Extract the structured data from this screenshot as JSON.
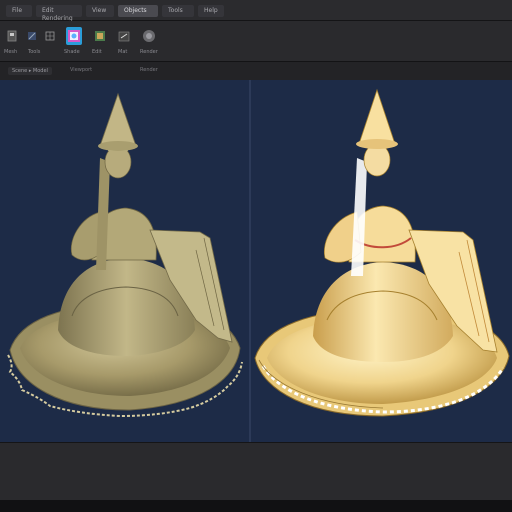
{
  "menubar": {
    "items": [
      {
        "label": "File"
      },
      {
        "label": "Edit Rendering"
      },
      {
        "label": "View"
      },
      {
        "label": "Objects"
      },
      {
        "label": "Tools"
      },
      {
        "label": "Help"
      }
    ]
  },
  "toolbar": {
    "tools": [
      {
        "icon": "move-icon"
      },
      {
        "icon": "transform-icon"
      },
      {
        "icon": "material-icon"
      },
      {
        "icon": "grid-icon"
      },
      {
        "icon": "render-icon"
      },
      {
        "icon": "viewport-icon"
      }
    ],
    "labels": [
      "Mesh",
      "Tools",
      "Shade",
      "Edit",
      "Mat",
      "Render"
    ]
  },
  "subbar": {
    "breadcrumb": "Scene ▸ Model",
    "view_left_label": "Viewport",
    "view_right_label": "Render"
  },
  "viewports": {
    "left": {
      "mode": "clay",
      "model": "figurine"
    },
    "right": {
      "mode": "rendered",
      "model": "figurine"
    }
  },
  "colors": {
    "viewport_bg": "#1d2b47",
    "clay": "#b8ac7c",
    "rendered": "#f2d890",
    "accent": "#2b9dd8"
  },
  "status": {
    "text": ""
  }
}
